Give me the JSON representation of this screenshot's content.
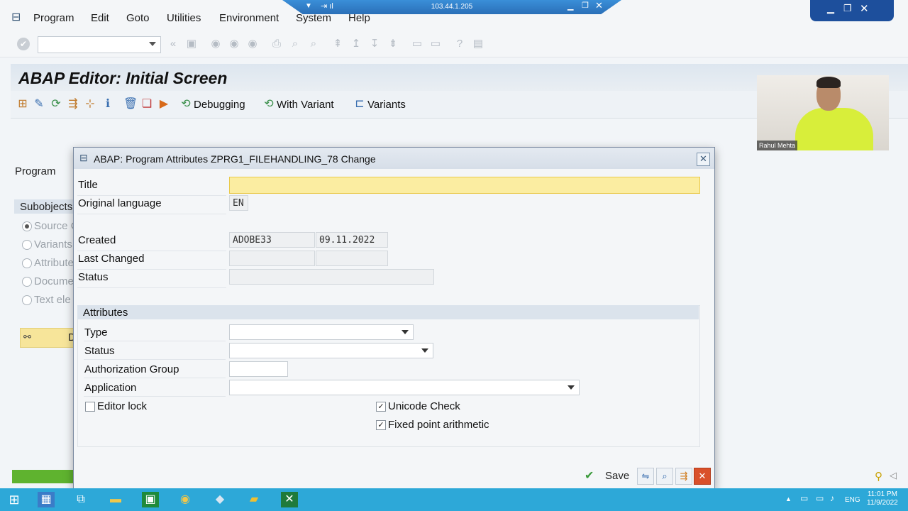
{
  "remote": {
    "ip": "103.44.1.205"
  },
  "menubar": {
    "items": [
      "Program",
      "Edit",
      "Goto",
      "Utilities",
      "Environment",
      "System",
      "Help"
    ]
  },
  "screen": {
    "title": "ABAP Editor: Initial Screen",
    "app_toolbar": {
      "debugging_label": "Debugging",
      "with_variant_label": "With Variant",
      "variants_label": "Variants"
    },
    "program_label": "Program",
    "subobjects_label": "Subobjects",
    "subobjects": [
      {
        "label": "Source C",
        "selected": true
      },
      {
        "label": "Variants",
        "selected": false
      },
      {
        "label": "Attribute",
        "selected": false
      },
      {
        "label": "Docume",
        "selected": false
      },
      {
        "label": "Text ele",
        "selected": false
      }
    ],
    "display_button_label": "D"
  },
  "webcam": {
    "name": "Rahul Mehta"
  },
  "dialog": {
    "title": "ABAP: Program Attributes ZPRG1_FILEHANDLING_78 Change",
    "fields": {
      "title_label": "Title",
      "title_value": "",
      "orig_lang_label": "Original language",
      "orig_lang_value": "EN",
      "created_label": "Created",
      "created_by": "ADOBE33",
      "created_on": "09.11.2022",
      "last_changed_label": "Last Changed",
      "last_changed_by": "",
      "last_changed_on": "",
      "status_label": "Status",
      "status_value": ""
    },
    "attributes": {
      "section_label": "Attributes",
      "type_label": "Type",
      "type_value": "",
      "status_label": "Status",
      "status_value": "",
      "auth_group_label": "Authorization Group",
      "auth_group_value": "",
      "application_label": "Application",
      "application_value": "",
      "editor_lock_label": "Editor lock",
      "editor_lock_checked": false,
      "unicode_label": "Unicode Check",
      "unicode_checked": true,
      "fixed_point_label": "Fixed point arithmetic",
      "fixed_point_checked": true
    },
    "footer": {
      "save_label": "Save"
    }
  },
  "taskbar": {
    "language": "ENG",
    "time": "11:01 PM",
    "date": "11/9/2022"
  },
  "colors": {
    "title_field_bg": "#fbeda1",
    "progress": "#5fb32f",
    "taskbar": "#2da8d8"
  }
}
